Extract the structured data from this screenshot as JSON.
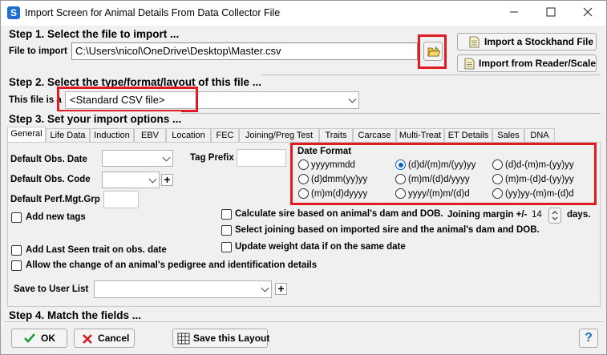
{
  "window": {
    "title": "Import Screen for Animal Details From Data Collector File",
    "minimize": "—",
    "maximize": "☐",
    "close": "✕"
  },
  "step1": {
    "header": "Step 1. Select the file to import ...",
    "file_label": "File to import",
    "file_value": "C:\\Users\\nicol\\OneDrive\\Desktop\\Master.csv",
    "import_stockhand": "Import a Stockhand File",
    "import_reader": "Import from Reader/Scale"
  },
  "step2": {
    "header": "Step 2. Select the type/format/layout of this file ...",
    "file_type_label": "This file is a",
    "file_type_value": "<Standard CSV file>"
  },
  "step3": {
    "header": "Step 3. Set your import options ...",
    "tabs": [
      "General",
      "Life Data",
      "Induction",
      "EBV",
      "Location",
      "FEC",
      "Joining/Preg Test",
      "Traits",
      "Carcase",
      "Multi-Treat",
      "ET Details",
      "Sales",
      "DNA"
    ],
    "default_obs_date": "Default Obs. Date",
    "default_obs_code": "Default Obs. Code",
    "default_perf_grp": "Default Perf.Mgt.Grp",
    "tag_prefix": "Tag Prefix",
    "add_new_tags": "Add new tags",
    "add_last_seen": "Add Last Seen trait on obs. date",
    "allow_pedigree": "Allow the change of an animal's pedigree and identification details",
    "save_to_user_list": "Save to User List",
    "calc_sire": "Calculate sire based on animal's dam and DOB.",
    "joining_margin_label": "Joining margin +/-",
    "joining_margin_value": "14",
    "days": "days.",
    "select_joining": "Select joining based on imported sire and the animal's dam and DOB.",
    "update_weight": "Update weight data if on the same date",
    "date_format": {
      "title": "Date Format",
      "options": [
        [
          "yyyymmdd",
          "(d)d/(m)m/(yy)yy",
          "(d)d-(m)m-(yy)yy"
        ],
        [
          "(d)dmm(yy)yy",
          "(m)m/(d)d/yyyy",
          "(m)m-(d)d-(yy)yy"
        ],
        [
          "(m)m(d)dyyyy",
          "yyyy/(m)m/(d)d",
          "(yy)yy-(m)m-(d)d"
        ]
      ],
      "selected": "(d)d/(m)m/(yy)yy"
    }
  },
  "step4": {
    "header": "Step 4. Match the fields ..."
  },
  "footer": {
    "ok": "OK",
    "cancel": "Cancel",
    "save_layout": "Save this Layout",
    "help": "?"
  },
  "colors": {
    "highlight": "#e01b24",
    "selected_radio": "#0b63c4",
    "ok_check": "#1e9e2e",
    "cancel_x": "#d01c1c"
  }
}
